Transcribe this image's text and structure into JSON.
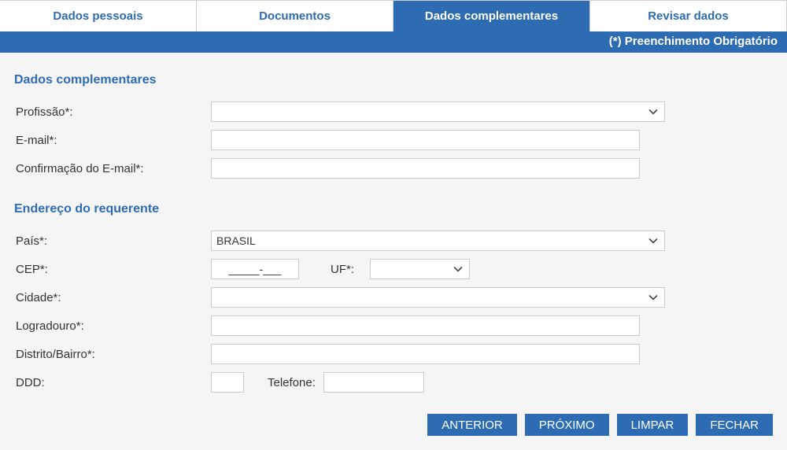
{
  "tabs": [
    {
      "label": "Dados pessoais"
    },
    {
      "label": "Documentos"
    },
    {
      "label": "Dados complementares"
    },
    {
      "label": "Revisar dados"
    }
  ],
  "required_note": "(*) Preenchimento Obrigatório",
  "sections": {
    "complementares": {
      "title": "Dados complementares",
      "fields": {
        "profissao": {
          "label": "Profissão*:",
          "value": ""
        },
        "email": {
          "label": "E-mail*:",
          "value": ""
        },
        "email_confirm": {
          "label": "Confirmação do E-mail*:",
          "value": ""
        }
      }
    },
    "endereco": {
      "title": "Endereço do requerente",
      "fields": {
        "pais": {
          "label": "País*:",
          "value": "BRASIL"
        },
        "cep": {
          "label": "CEP*:",
          "value": "_____-___"
        },
        "uf": {
          "label": "UF*:",
          "value": ""
        },
        "cidade": {
          "label": "Cidade*:",
          "value": ""
        },
        "logradouro": {
          "label": "Logradouro*:",
          "value": ""
        },
        "distrito": {
          "label": "Distrito/Bairro*:",
          "value": ""
        },
        "ddd": {
          "label": "DDD:",
          "value": ""
        },
        "telefone": {
          "label": "Telefone:",
          "value": ""
        }
      }
    }
  },
  "buttons": {
    "anterior": "ANTERIOR",
    "proximo": "PRÓXIMO",
    "limpar": "LIMPAR",
    "fechar": "FECHAR"
  }
}
